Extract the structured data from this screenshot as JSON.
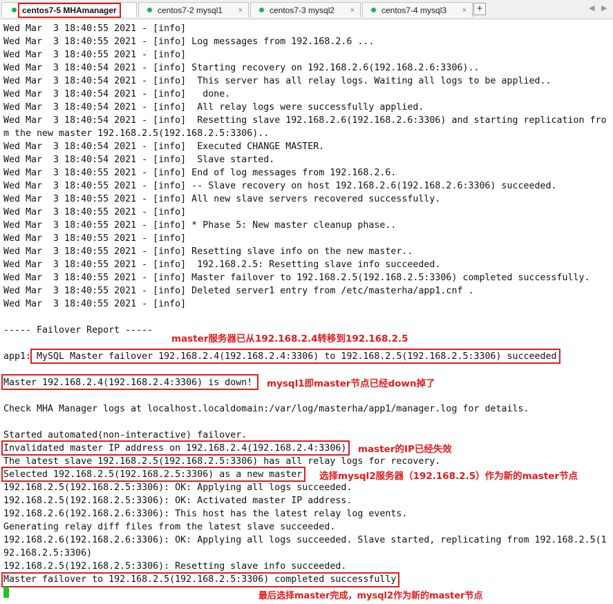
{
  "tabs": [
    {
      "label": "centos7-5 MHAmanager",
      "active": true,
      "close": ""
    },
    {
      "label": "centos7-2 mysql1",
      "active": false,
      "close": "×"
    },
    {
      "label": "centos7-3 mysql2",
      "active": false,
      "close": "×"
    },
    {
      "label": "centos7-4 mysql3",
      "active": false,
      "close": "×"
    }
  ],
  "add_tab": "+",
  "nav_prev": "◀",
  "nav_next": "▶",
  "terminal_lines": [
    "Wed Mar  3 18:40:55 2021 - [info]",
    "Wed Mar  3 18:40:55 2021 - [info] Log messages from 192.168.2.6 ...",
    "Wed Mar  3 18:40:55 2021 - [info]",
    "Wed Mar  3 18:40:54 2021 - [info] Starting recovery on 192.168.2.6(192.168.2.6:3306)..",
    "Wed Mar  3 18:40:54 2021 - [info]  This server has all relay logs. Waiting all logs to be applied..",
    "Wed Mar  3 18:40:54 2021 - [info]   done.",
    "Wed Mar  3 18:40:54 2021 - [info]  All relay logs were successfully applied.",
    "Wed Mar  3 18:40:54 2021 - [info]  Resetting slave 192.168.2.6(192.168.2.6:3306) and starting replication fro",
    "m the new master 192.168.2.5(192.168.2.5:3306)..",
    "Wed Mar  3 18:40:54 2021 - [info]  Executed CHANGE MASTER.",
    "Wed Mar  3 18:40:54 2021 - [info]  Slave started.",
    "Wed Mar  3 18:40:55 2021 - [info] End of log messages from 192.168.2.6.",
    "Wed Mar  3 18:40:55 2021 - [info] -- Slave recovery on host 192.168.2.6(192.168.2.6:3306) succeeded.",
    "Wed Mar  3 18:40:55 2021 - [info] All new slave servers recovered successfully.",
    "Wed Mar  3 18:40:55 2021 - [info]",
    "Wed Mar  3 18:40:55 2021 - [info] * Phase 5: New master cleanup phase..",
    "Wed Mar  3 18:40:55 2021 - [info]",
    "Wed Mar  3 18:40:55 2021 - [info] Resetting slave info on the new master..",
    "Wed Mar  3 18:40:55 2021 - [info]  192.168.2.5: Resetting slave info succeeded.",
    "Wed Mar  3 18:40:55 2021 - [info] Master failover to 192.168.2.5(192.168.2.5:3306) completed successfully.",
    "Wed Mar  3 18:40:55 2021 - [info] Deleted server1 entry from /etc/masterha/app1.cnf .",
    "Wed Mar  3 18:40:55 2021 - [info]",
    "",
    "----- Failover Report -----",
    "",
    "app1: MySQL Master failover 192.168.2.4(192.168.2.4:3306) to 192.168.2.5(192.168.2.5:3306) succeeded",
    "",
    "Master 192.168.2.4(192.168.2.4:3306) is down!",
    "",
    "Check MHA Manager logs at localhost.localdomain:/var/log/masterha/app1/manager.log for details.",
    "",
    "Started automated(non-interactive) failover.",
    "Invalidated master IP address on 192.168.2.4(192.168.2.4:3306)",
    "The latest slave 192.168.2.5(192.168.2.5:3306) has all relay logs for recovery.",
    "Selected 192.168.2.5(192.168.2.5:3306) as a new master.",
    "192.168.2.5(192.168.2.5:3306): OK: Applying all logs succeeded.",
    "192.168.2.5(192.168.2.5:3306): OK: Activated master IP address.",
    "192.168.2.6(192.168.2.6:3306): This host has the latest relay log events.",
    "Generating relay diff files from the latest slave succeeded.",
    "192.168.2.6(192.168.2.6:3306): OK: Applying all logs succeeded. Slave started, replicating from 192.168.2.5(1",
    "92.168.2.5:3306)",
    "192.168.2.5(192.168.2.5:3306): Resetting slave info succeeded.",
    "Master failover to 192.168.2.5(192.168.2.5:3306) completed successfully."
  ],
  "annotations": [
    "master服务器已从192.168.2.4转移到192.168.2.5",
    "mysql1即master节点已经down掉了",
    "master的IP已经失效",
    "选择mysql2服务器（192.168.2.5）作为新的master节点",
    "最后选择master完成，mysql2作为新的master节点"
  ],
  "colors": {
    "annotation_red": "#e21b1b",
    "status_dot_green": "#1fb14c",
    "cursor_green": "#22c522"
  }
}
